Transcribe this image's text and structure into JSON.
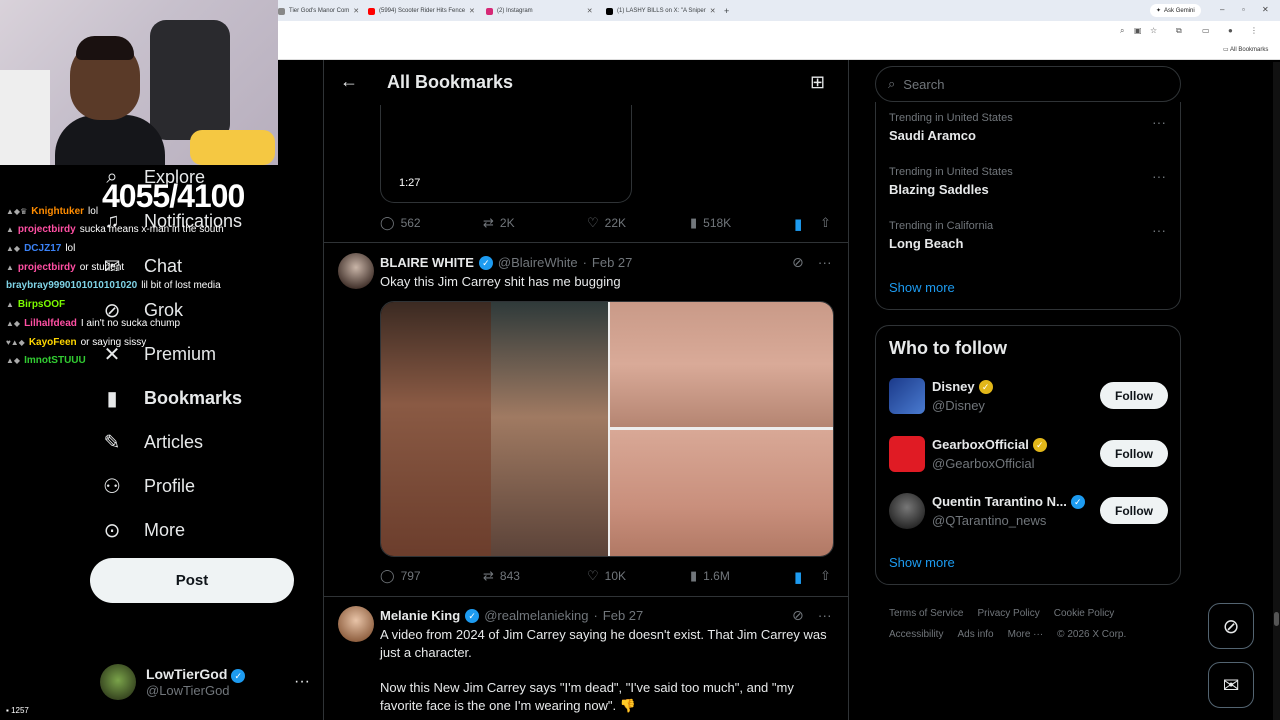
{
  "browser": {
    "tabs": [
      {
        "label": "Tier God's Manor Com",
        "color": "#888888"
      },
      {
        "label": "(5994) Scooter Rider Hits Fence",
        "color": "#ff0000"
      },
      {
        "label": "(2) Instagram",
        "color": "#d62976"
      },
      {
        "label": "(1) LASHY BILLS on X: \"A Sniper",
        "color": "#000000"
      }
    ],
    "new_tab": "+",
    "gemini_label": "Ask Gemini",
    "bookmarks_label": "All Bookmarks"
  },
  "overlay": {
    "counter": "4055/4100",
    "viewers": "1257",
    "chat": [
      {
        "user": "Knightuker",
        "user_color": "#ff8c00",
        "msg": "lol"
      },
      {
        "user": "projectbirdy",
        "user_color": "#ff4fa3",
        "msg": "sucka means x-man in the south"
      },
      {
        "user": "DCJZ17",
        "user_color": "#3b82f6",
        "msg": "lol"
      },
      {
        "user": "projectbirdy",
        "user_color": "#ff4fa3",
        "msg": "or student"
      },
      {
        "user": "braybray9990101010101020",
        "user_color": "#7fd3e6",
        "msg": "lil bit of lost media"
      },
      {
        "user": "BirpsOOF",
        "user_color": "#7CFC00",
        "msg": ""
      },
      {
        "user": "Lilhalfdead",
        "user_color": "#ff4fa3",
        "msg": "I ain't no sucka chump"
      },
      {
        "user": "KayoFeen",
        "user_color": "#ffd700",
        "msg": "or saying sissy"
      },
      {
        "user": "ImnotSTUUU",
        "user_color": "#32cd32",
        "msg": ""
      }
    ]
  },
  "nav": {
    "items": [
      {
        "label": "Explore",
        "icon": "search-icon",
        "glyph": "⌕"
      },
      {
        "label": "Notifications",
        "icon": "bell-icon",
        "glyph": "🔔"
      },
      {
        "label": "Chat",
        "icon": "mail-icon",
        "glyph": "✉"
      },
      {
        "label": "Grok",
        "icon": "grok-icon",
        "glyph": "⊘"
      },
      {
        "label": "Premium",
        "icon": "x-logo-icon",
        "glyph": "✕"
      },
      {
        "label": "Bookmarks",
        "icon": "bookmark-icon",
        "glyph": "🔖"
      },
      {
        "label": "Articles",
        "icon": "article-icon",
        "glyph": "✎"
      },
      {
        "label": "Profile",
        "icon": "person-icon",
        "glyph": "👤"
      },
      {
        "label": "More",
        "icon": "more-circle-icon",
        "glyph": "⋯"
      }
    ],
    "post_label": "Post",
    "account": {
      "name": "LowTierGod",
      "handle": "@LowTierGod"
    }
  },
  "main": {
    "title": "All Bookmarks",
    "top_tweet": {
      "duration": "1:27",
      "replies": "562",
      "reposts": "2K",
      "likes": "22K",
      "views": "518K"
    },
    "tweets": [
      {
        "name": "BLAIRE WHITE",
        "handle": "@BlaireWhite",
        "date": "Feb 27",
        "text": "Okay this Jim Carrey shit has me bugging",
        "replies": "797",
        "reposts": "843",
        "likes": "10K",
        "views": "1.6M"
      },
      {
        "name": "Melanie King",
        "handle": "@realmelanieking",
        "date": "Feb 27",
        "text1": "A video from 2024 of Jim Carrey saying he doesn't exist. That Jim Carrey was just a character.",
        "text2": "Now this New Jim Carrey says \"I'm dead\", \"I've said too much\", and \"my favorite face is the one I'm wearing now\". 👎"
      }
    ]
  },
  "right": {
    "search_placeholder": "Search",
    "trends": [
      {
        "context": "Trending in United States",
        "topic": "Saudi Aramco"
      },
      {
        "context": "Trending in United States",
        "topic": "Blazing Saddles"
      },
      {
        "context": "Trending in California",
        "topic": "Long Beach"
      }
    ],
    "show_more": "Show more",
    "who_to_follow_title": "Who to follow",
    "suggestions": [
      {
        "name": "Disney",
        "handle": "@Disney",
        "badge": "gold",
        "avatar_color": "#1b3a8a"
      },
      {
        "name": "GearboxOfficial",
        "handle": "@GearboxOfficial",
        "badge": "gold",
        "avatar_color": "#e01b24"
      },
      {
        "name": "Quentin Tarantino N...",
        "handle": "@QTarantino_news",
        "badge": "blue",
        "avatar_color": "#333333"
      }
    ],
    "follow_label": "Follow",
    "footer": [
      "Terms of Service",
      "Privacy Policy",
      "Cookie Policy",
      "Accessibility",
      "Ads info",
      "More ···",
      "© 2026 X Corp."
    ]
  }
}
